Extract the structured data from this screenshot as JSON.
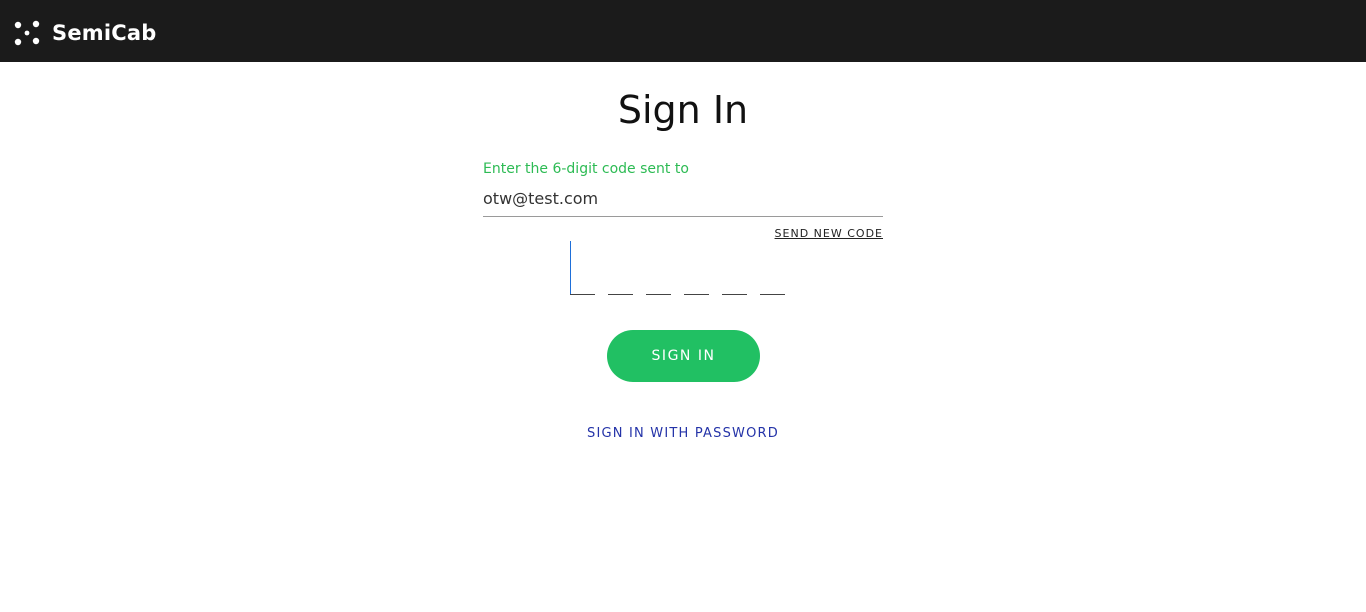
{
  "header": {
    "brand_name": "SemiCab",
    "logo_icon": "semicab-dots-icon"
  },
  "page": {
    "title": "Sign In"
  },
  "form": {
    "prompt": "Enter the 6-digit code sent to",
    "email_value": "otw@test.com",
    "resend_label": "SEND NEW CODE",
    "code_digits": [
      "",
      "",
      "",
      "",
      "",
      ""
    ],
    "submit_label": "SIGN IN",
    "password_link_label": "SIGN IN WITH PASSWORD"
  },
  "colors": {
    "header_bg": "#1b1b1b",
    "accent_green": "#21c063",
    "prompt_green": "#2dbb54",
    "link_blue": "#2433a8"
  }
}
